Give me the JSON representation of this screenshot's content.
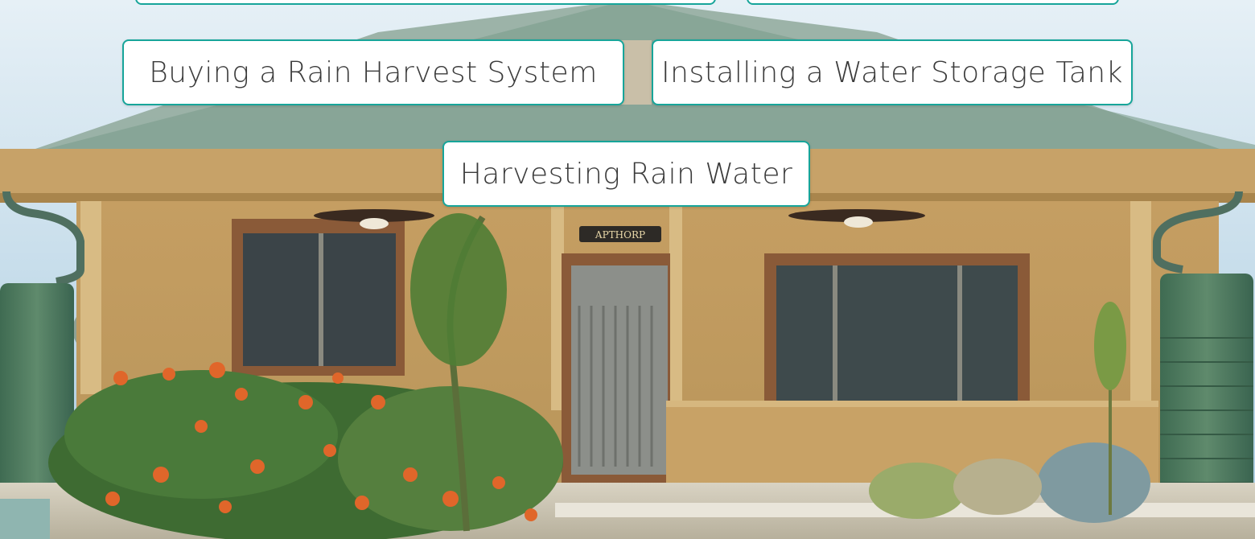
{
  "links": [
    {
      "label": "Buying a Rain Harvest System"
    },
    {
      "label": "Installing a Water Storage Tank"
    },
    {
      "label": "Harvesting Rain Water"
    }
  ],
  "sign_text": "APTHORP",
  "colors": {
    "accent_border": "#17a59a",
    "pill_background": "#ffffff",
    "pill_text": "#3b3b3b",
    "wall": "#c9a86a",
    "roof": "#6f9a86",
    "tank": "#4f7a5f"
  }
}
